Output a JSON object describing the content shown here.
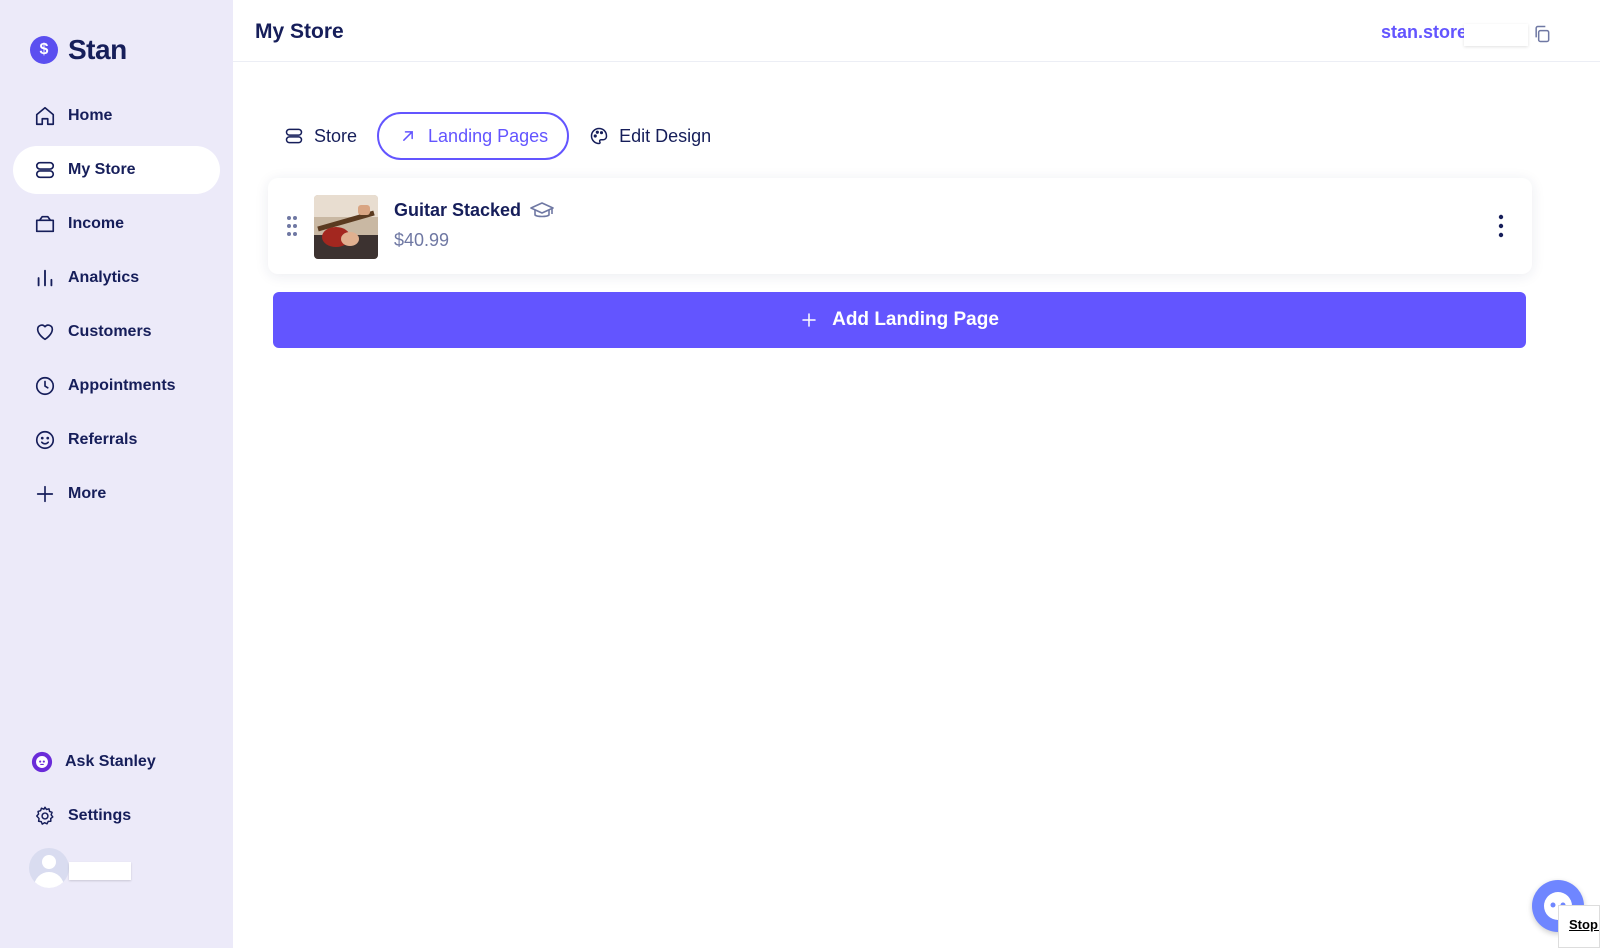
{
  "brand": {
    "name": "Stan",
    "mark": "$"
  },
  "sidebar": {
    "items": [
      {
        "label": "Home",
        "icon": "home-icon"
      },
      {
        "label": "My Store",
        "icon": "store-icon",
        "active": true
      },
      {
        "label": "Income",
        "icon": "wallet-icon"
      },
      {
        "label": "Analytics",
        "icon": "bar-chart-icon"
      },
      {
        "label": "Customers",
        "icon": "heart-icon"
      },
      {
        "label": "Appointments",
        "icon": "clock-icon"
      },
      {
        "label": "Referrals",
        "icon": "smiley-icon"
      },
      {
        "label": "More",
        "icon": "plus-icon"
      }
    ],
    "bottom": [
      {
        "label": "Ask Stanley",
        "icon": "stanley-bot-icon"
      },
      {
        "label": "Settings",
        "icon": "gear-icon"
      }
    ]
  },
  "header": {
    "title": "My Store",
    "store_link": "stan.store"
  },
  "tabs": [
    {
      "label": "Store",
      "icon": "store-icon"
    },
    {
      "label": "Landing Pages",
      "icon": "arrow-up-right-icon",
      "active": true
    },
    {
      "label": "Edit Design",
      "icon": "palette-icon"
    }
  ],
  "products": [
    {
      "title": "Guitar Stacked",
      "price": "$40.99",
      "type_icon": "graduation-cap-icon"
    }
  ],
  "add_button": {
    "label": "Add Landing Page"
  },
  "corner_note": {
    "text": "Stop WINN"
  },
  "colors": {
    "accent": "#6355ff",
    "sidebar_bg": "#eceaf9",
    "text": "#161e5a"
  }
}
